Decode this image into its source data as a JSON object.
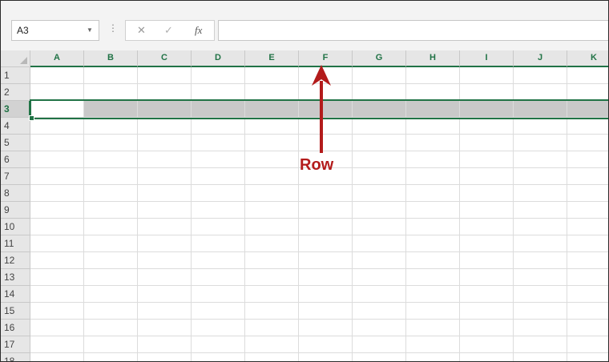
{
  "formula_bar": {
    "name_box": "A3",
    "dots": "⋮",
    "cancel": "✕",
    "enter": "✓",
    "fx": "fx",
    "formula": ""
  },
  "columns": [
    "A",
    "B",
    "C",
    "D",
    "E",
    "F",
    "G",
    "H",
    "I",
    "J",
    "K"
  ],
  "rows": [
    "1",
    "2",
    "3",
    "4",
    "5",
    "6",
    "7",
    "8",
    "9",
    "10",
    "11",
    "12",
    "13",
    "14",
    "15",
    "16",
    "17",
    "18"
  ],
  "selected_row": "3",
  "annotation": {
    "label": "Row",
    "color": "#b31b1b"
  },
  "colors": {
    "accent": "#217346",
    "selection_fill": "#c9c9c9"
  }
}
